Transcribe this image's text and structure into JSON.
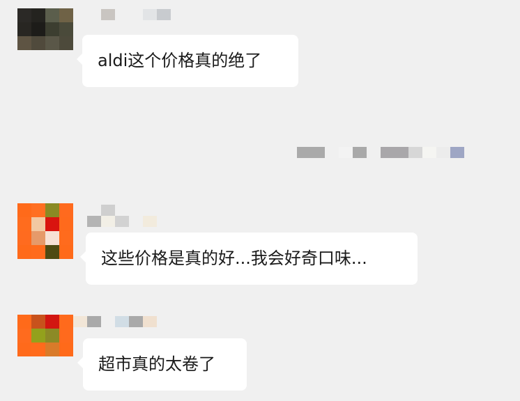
{
  "colors": {
    "background": "#f0f0f0",
    "bubble": "#ffffff",
    "text": "#1a1a1a"
  },
  "messages": [
    {
      "avatar_palette": "dark-olive-blurred",
      "text": "aldi这个价格真的绝了"
    },
    {
      "avatar_palette": "orange-red-blurred",
      "text": "这些价格是真的好...我会好奇口味..."
    },
    {
      "avatar_palette": "orange-olive-blurred",
      "text": "超市真的太卷了"
    }
  ]
}
